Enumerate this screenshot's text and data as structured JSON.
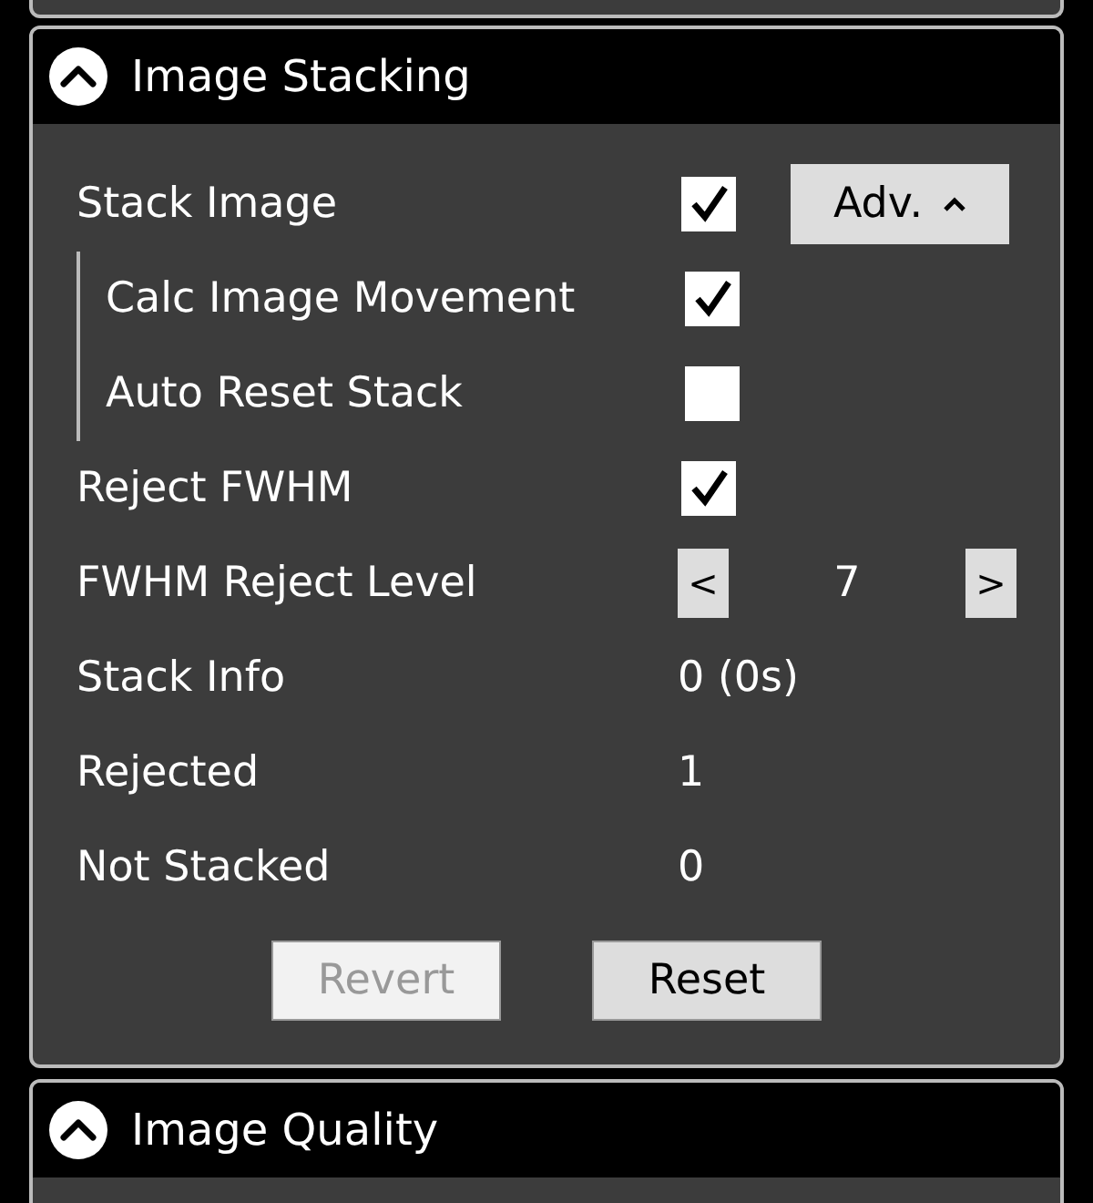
{
  "stacking_panel": {
    "title": "Image Stacking",
    "expanded": true,
    "adv_button": "Adv.",
    "rows": [
      {
        "kind": "checkbox",
        "label": "Stack Image",
        "checked": true,
        "children": [
          {
            "kind": "checkbox",
            "label": "Calc Image Movement",
            "checked": true
          },
          {
            "kind": "checkbox",
            "label": "Auto Reset Stack",
            "checked": false
          }
        ]
      },
      {
        "kind": "checkbox",
        "label": "Reject FWHM",
        "checked": true
      },
      {
        "kind": "stepper",
        "label": "FWHM Reject Level",
        "value": "7",
        "decrement": "<",
        "increment": ">"
      },
      {
        "kind": "info",
        "label": "Stack Info",
        "value": "0 (0s)"
      },
      {
        "kind": "info",
        "label": "Rejected",
        "value": "1"
      },
      {
        "kind": "info",
        "label": "Not Stacked",
        "value": "0"
      }
    ],
    "buttons": [
      {
        "label": "Revert",
        "disabled": true
      },
      {
        "label": "Reset",
        "disabled": false
      }
    ]
  },
  "quality_panel": {
    "title": "Image Quality",
    "expanded": true
  }
}
